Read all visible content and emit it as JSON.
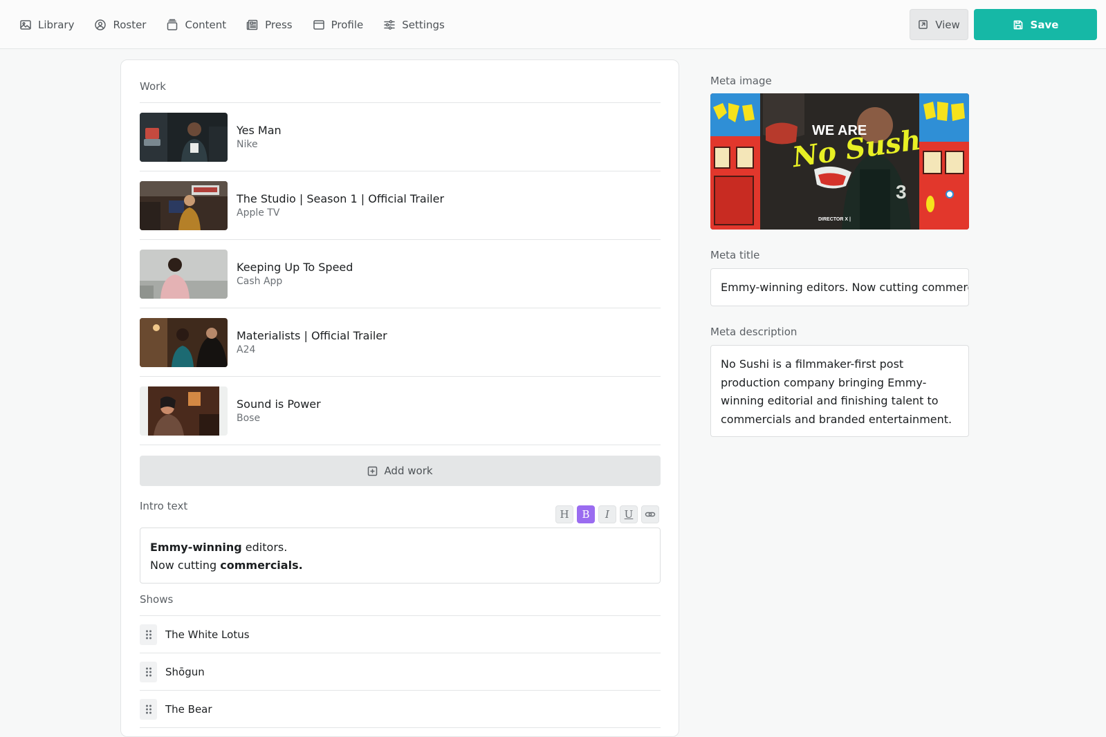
{
  "nav": {
    "items": [
      {
        "label": "Library",
        "icon": "image-icon"
      },
      {
        "label": "Roster",
        "icon": "user-circle-icon"
      },
      {
        "label": "Content",
        "icon": "stack-icon"
      },
      {
        "label": "Press",
        "icon": "newspaper-icon"
      },
      {
        "label": "Profile",
        "icon": "browser-window-icon"
      },
      {
        "label": "Settings",
        "icon": "sliders-icon"
      }
    ]
  },
  "actions": {
    "view_label": "View",
    "save_label": "Save",
    "accent": "#16b8a6"
  },
  "work": {
    "label": "Work",
    "items": [
      {
        "title": "Yes Man",
        "client": "Nike"
      },
      {
        "title": "The Studio | Season 1 | Official Trailer",
        "client": "Apple TV"
      },
      {
        "title": "Keeping Up To Speed",
        "client": "Cash App"
      },
      {
        "title": "Materialists | Official Trailer",
        "client": "A24"
      },
      {
        "title": "Sound is Power",
        "client": "Bose"
      }
    ],
    "add_label": "Add work"
  },
  "intro": {
    "label": "Intro text",
    "line1_bold": "Emmy-winning",
    "line1_rest": " editors.",
    "line2_rest": "Now cutting ",
    "line2_bold": "commercials.",
    "toolbar": [
      {
        "name": "heading",
        "glyph": "H"
      },
      {
        "name": "bold",
        "glyph": "B",
        "active": true
      },
      {
        "name": "italic",
        "glyph": "I"
      },
      {
        "name": "underline",
        "glyph": "U"
      },
      {
        "name": "link",
        "glyph": "link-icon"
      }
    ],
    "active_color": "#9a6cf0"
  },
  "shows": {
    "label": "Shows",
    "items": [
      "The White Lotus",
      "Shōgun",
      "The Bear"
    ]
  },
  "meta": {
    "image_label": "Meta image",
    "image_text": {
      "line1": "WE ARE",
      "line2": "No Sushi",
      "credit": "DIRECTOR X |"
    },
    "title_label": "Meta title",
    "title_value": "Emmy-winning editors. Now cutting commercials.",
    "description_label": "Meta description",
    "description_value": "No Sushi is a filmmaker-first post production company bringing Emmy-winning editorial and finishing talent to commercials and branded entertainment."
  }
}
